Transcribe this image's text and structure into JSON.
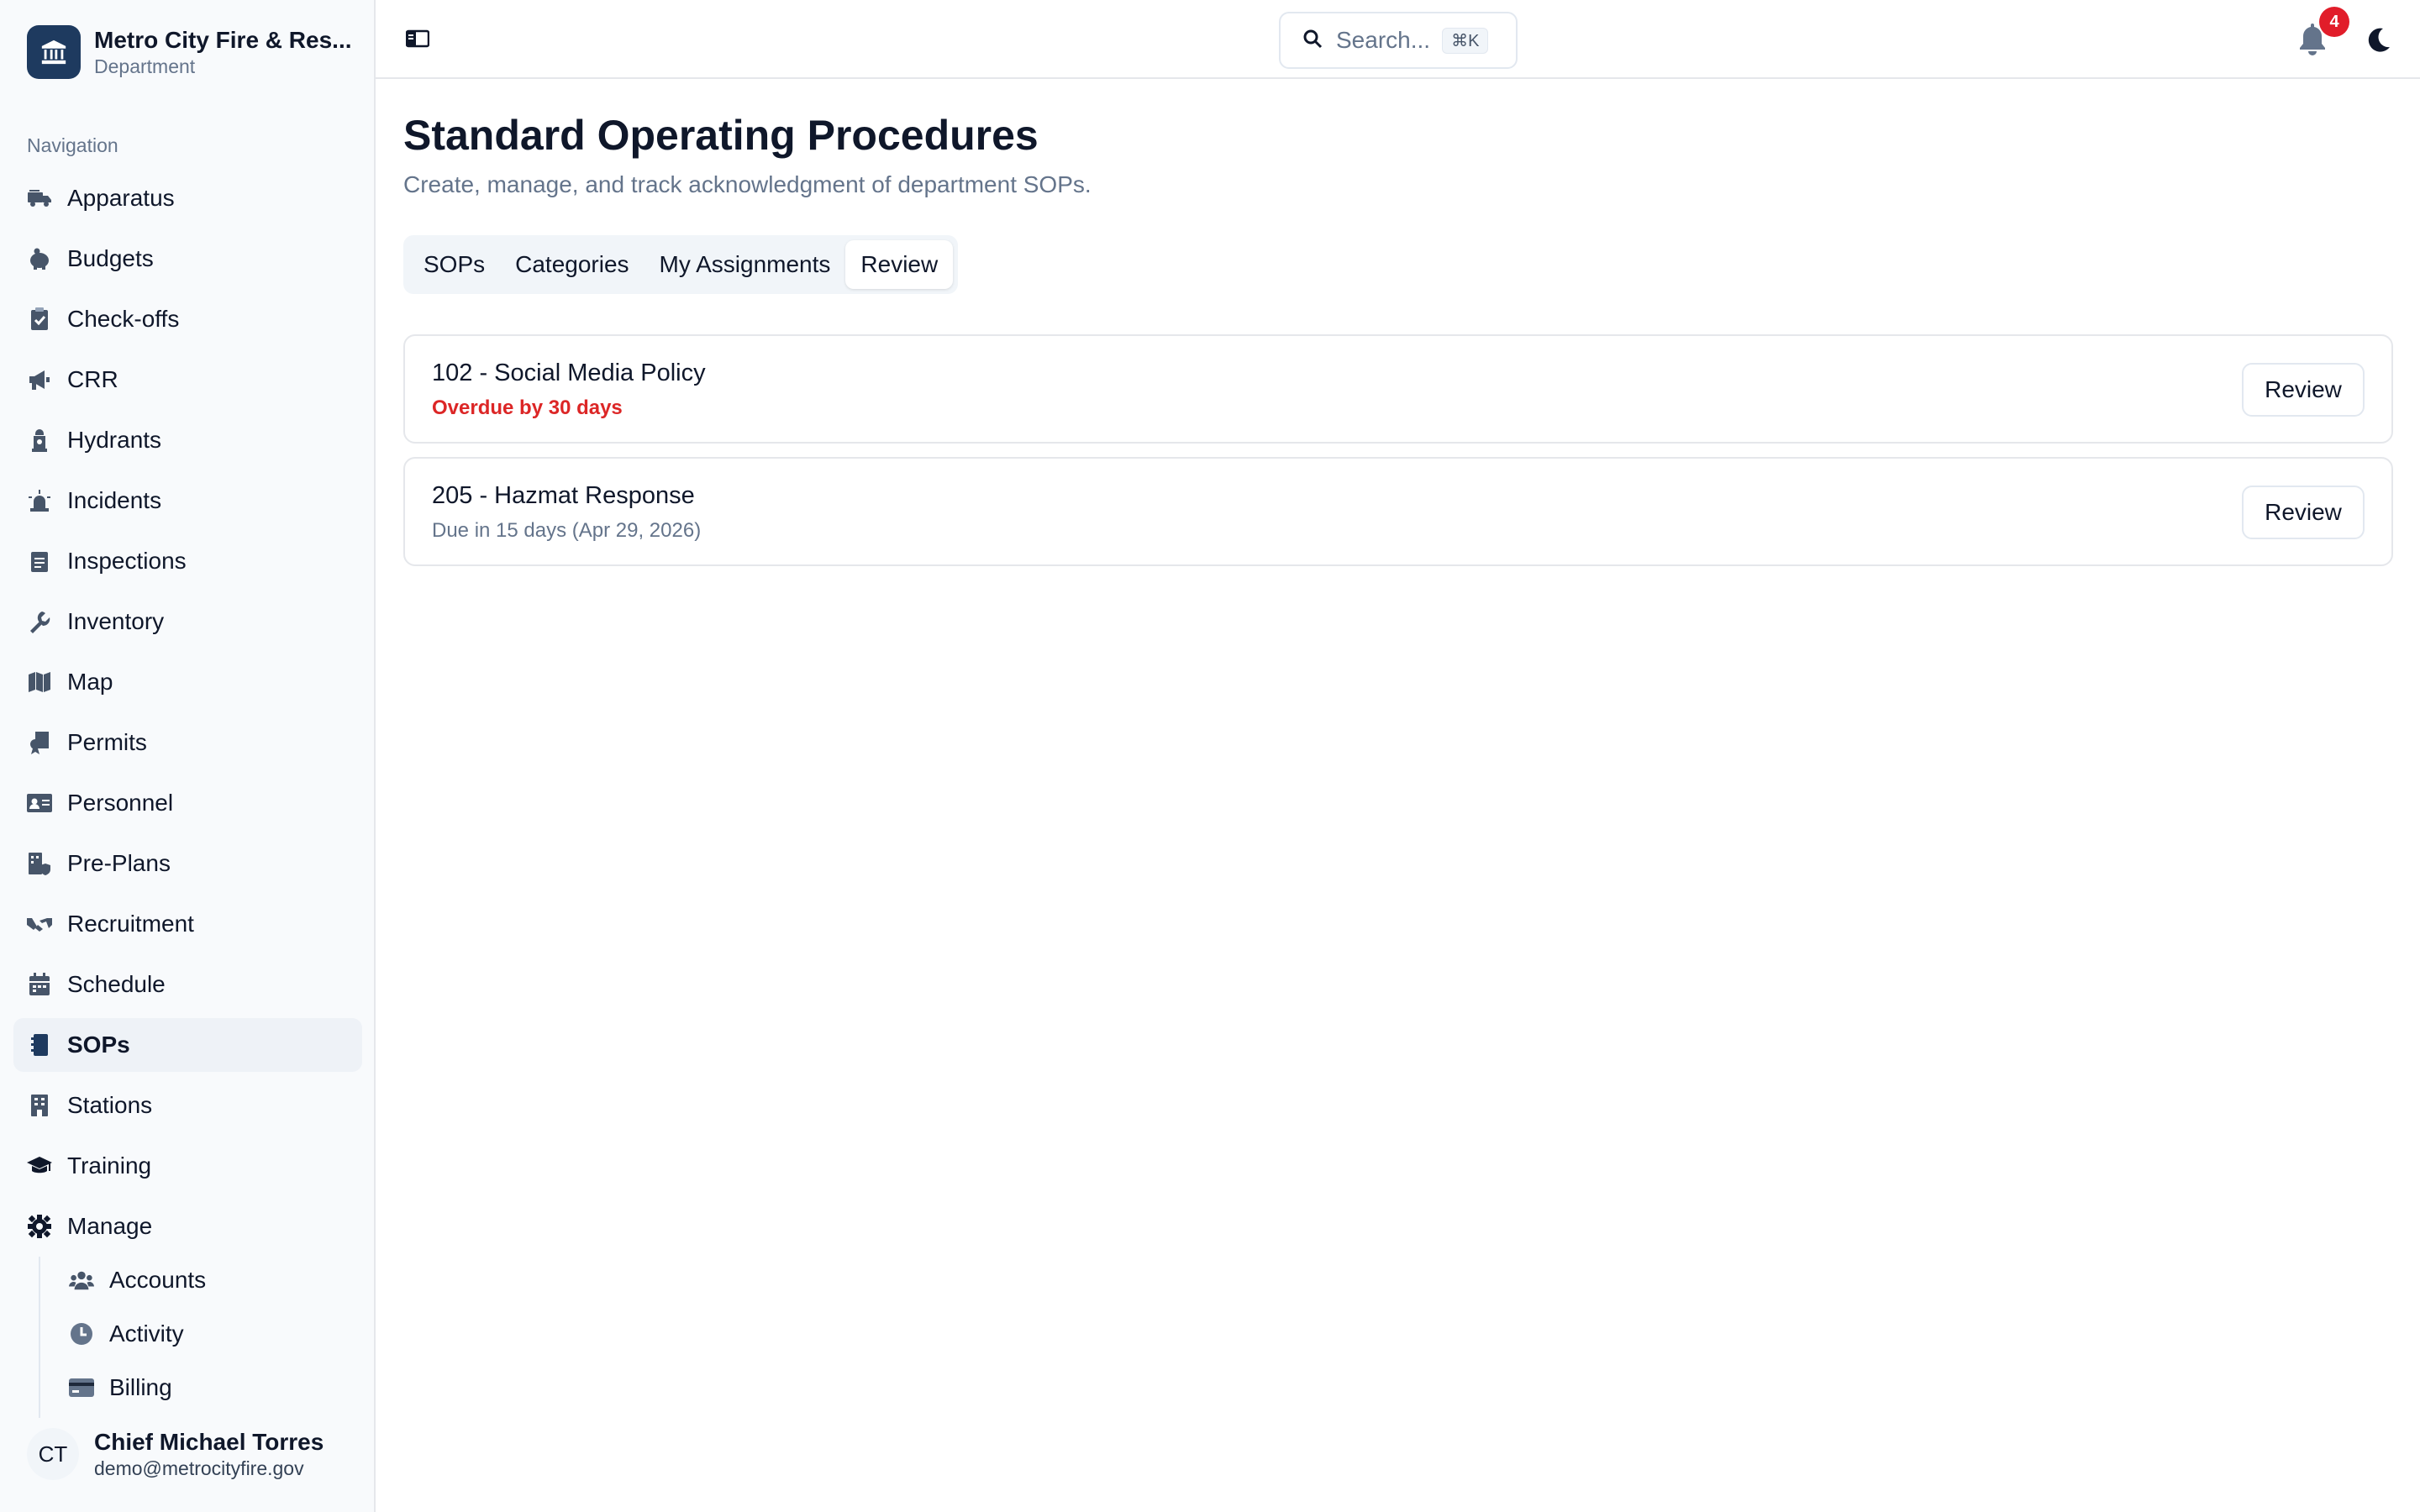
{
  "org": {
    "name": "Metro City Fire & Res...",
    "type": "Department"
  },
  "sidebar": {
    "heading": "Navigation",
    "items": [
      {
        "label": "Apparatus",
        "icon": "fire-truck-icon"
      },
      {
        "label": "Budgets",
        "icon": "piggy-bank-icon"
      },
      {
        "label": "Check-offs",
        "icon": "clipboard-check-icon"
      },
      {
        "label": "CRR",
        "icon": "megaphone-icon"
      },
      {
        "label": "Hydrants",
        "icon": "hydrant-icon"
      },
      {
        "label": "Incidents",
        "icon": "siren-icon"
      },
      {
        "label": "Inspections",
        "icon": "clipboard-list-icon"
      },
      {
        "label": "Inventory",
        "icon": "wrench-icon"
      },
      {
        "label": "Map",
        "icon": "map-icon"
      },
      {
        "label": "Permits",
        "icon": "permit-icon"
      },
      {
        "label": "Personnel",
        "icon": "id-card-icon"
      },
      {
        "label": "Pre-Plans",
        "icon": "building-shield-icon"
      },
      {
        "label": "Recruitment",
        "icon": "handshake-icon"
      },
      {
        "label": "Schedule",
        "icon": "calendar-icon"
      },
      {
        "label": "SOPs",
        "icon": "book-icon",
        "active": true
      },
      {
        "label": "Stations",
        "icon": "building-icon"
      },
      {
        "label": "Training",
        "icon": "graduation-cap-icon"
      },
      {
        "label": "Manage",
        "icon": "gear-icon"
      }
    ],
    "manage_items": [
      {
        "label": "Accounts",
        "icon": "users-icon"
      },
      {
        "label": "Activity",
        "icon": "clock-icon"
      },
      {
        "label": "Billing",
        "icon": "credit-card-icon"
      }
    ]
  },
  "user": {
    "initials": "CT",
    "name": "Chief Michael Torres",
    "email": "demo@metrocityfire.gov"
  },
  "header": {
    "search_placeholder": "Search...",
    "search_shortcut": "⌘K",
    "notification_count": "4"
  },
  "page": {
    "title": "Standard Operating Procedures",
    "subtitle": "Create, manage, and track acknowledgment of department SOPs."
  },
  "tabs": [
    {
      "label": "SOPs"
    },
    {
      "label": "Categories"
    },
    {
      "label": "My Assignments"
    },
    {
      "label": "Review",
      "active": true
    }
  ],
  "reviews": [
    {
      "title": "102 - Social Media Policy",
      "status": "Overdue by 30 days",
      "status_type": "overdue",
      "button": "Review"
    },
    {
      "title": "205 - Hazmat Response",
      "status": "Due in 15 days (Apr 29, 2026)",
      "status_type": "due",
      "button": "Review"
    }
  ],
  "colors": {
    "accent": "#1e3a5f",
    "overdue": "#dc2626",
    "badge": "#e11d2a",
    "icon": "#475569"
  }
}
